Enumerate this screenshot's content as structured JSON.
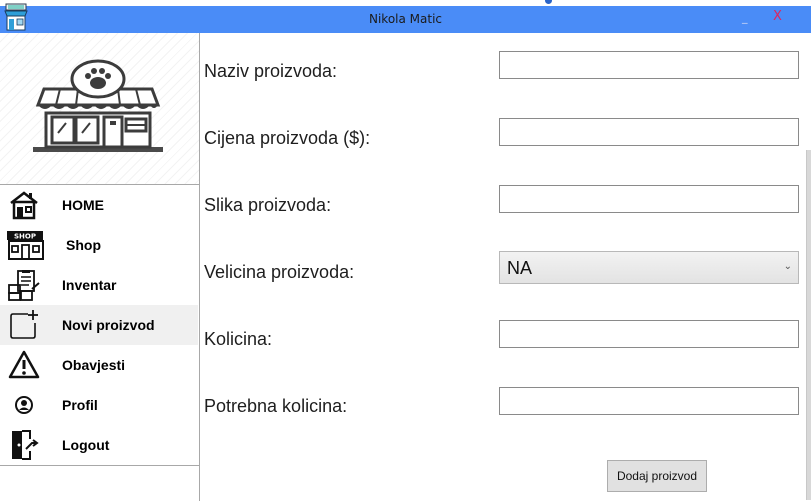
{
  "window": {
    "title": "Nikola Matic",
    "minimize_label": "_",
    "close_label": "X",
    "app_icon": "shop-app-icon"
  },
  "sidebar": {
    "logo_icon": "pet-shop-store-icon",
    "items": [
      {
        "label": "HOME",
        "icon": "home-icon"
      },
      {
        "label": "Shop",
        "icon": "shop-sign-icon"
      },
      {
        "label": "Inventar",
        "icon": "inventory-icon"
      },
      {
        "label": "Novi proizvod",
        "icon": "add-new-icon",
        "active": true
      },
      {
        "label": "Obavjesti",
        "icon": "warning-icon"
      },
      {
        "label": "Profil",
        "icon": "user-profile-icon"
      },
      {
        "label": "Logout",
        "icon": "logout-door-icon"
      }
    ]
  },
  "form": {
    "name_label": "Naziv proizvoda:",
    "name_value": "",
    "price_label": "Cijena proizvoda ($):",
    "price_value": "",
    "image_label": "Slika proizvoda:",
    "image_value": "",
    "size_label": "Velicina proizvoda:",
    "size_selected": "NA",
    "quantity_label": "Kolicina:",
    "quantity_value": "",
    "required_quantity_label": "Potrebna kolicina:",
    "required_quantity_value": "",
    "submit_label": "Dodaj proizvod"
  },
  "colors": {
    "titlebar": "#4a8cf7",
    "close": "#e0245e",
    "active_item": "#f0f0f0",
    "button": "#e1e1e1"
  }
}
